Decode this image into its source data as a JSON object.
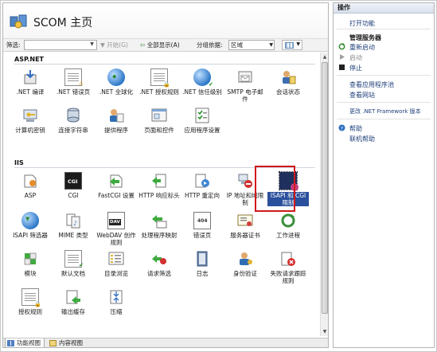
{
  "header": {
    "title": "SCOM 主页",
    "logo_icon": "iis-manager-logo-icon"
  },
  "toolbar": {
    "filter_label": "筛选:",
    "filter_value": "",
    "go_label": "▼ 开始(G)",
    "show_all_label": "全部显示(A)",
    "group_by_label": "分组依据:",
    "group_by_value": "区域",
    "view_icon": "view-tiles-icon"
  },
  "sections": [
    {
      "title": "ASP.NET",
      "items": [
        {
          "label": ".NET 编译",
          "icon": "net-compile-icon"
        },
        {
          "label": ".NET 错误页",
          "icon": "net-error-pages-icon"
        },
        {
          "label": ".NET 全球化",
          "icon": "net-globalization-icon"
        },
        {
          "label": ".NET 授权规则",
          "icon": "net-authorization-rules-icon"
        },
        {
          "label": ".NET 信任级别",
          "icon": "net-trust-levels-icon"
        },
        {
          "label": "SMTP 电子邮件",
          "icon": "smtp-email-icon"
        },
        {
          "label": "会话状态",
          "icon": "session-state-icon"
        },
        {
          "label": "计算机密钥",
          "icon": "machine-key-icon"
        },
        {
          "label": "连接字符串",
          "icon": "connection-strings-icon"
        },
        {
          "label": "提供程序",
          "icon": "providers-icon"
        },
        {
          "label": "页面和控件",
          "icon": "pages-controls-icon"
        },
        {
          "label": "应用程序设置",
          "icon": "application-settings-icon"
        }
      ]
    },
    {
      "title": "IIS",
      "items": [
        {
          "label": "ASP",
          "icon": "asp-icon"
        },
        {
          "label": "CGI",
          "icon": "cgi-icon"
        },
        {
          "label": "FastCGI 设置",
          "icon": "fastcgi-settings-icon"
        },
        {
          "label": "HTTP 响应标头",
          "icon": "http-response-headers-icon"
        },
        {
          "label": "HTTP 重定向",
          "icon": "http-redirect-icon"
        },
        {
          "label": "IP 地址和域限制",
          "icon": "ip-domain-restrictions-icon"
        },
        {
          "label": "ISAPI 和 CGI 限制",
          "icon": "isapi-cgi-restrictions-icon"
        },
        {
          "label": "ISAPI 筛选器",
          "icon": "isapi-filters-icon"
        },
        {
          "label": "MIME 类型",
          "icon": "mime-types-icon"
        },
        {
          "label": "WebDAV 创作规则",
          "icon": "webdav-authoring-rules-icon"
        },
        {
          "label": "处理程序映射",
          "icon": "handler-mappings-icon"
        },
        {
          "label": "错误页",
          "icon": "error-pages-icon"
        },
        {
          "label": "服务器证书",
          "icon": "server-certificates-icon"
        },
        {
          "label": "工作进程",
          "icon": "worker-processes-icon"
        },
        {
          "label": "模块",
          "icon": "modules-icon"
        },
        {
          "label": "默认文档",
          "icon": "default-document-icon"
        },
        {
          "label": "目录浏览",
          "icon": "directory-browsing-icon"
        },
        {
          "label": "请求筛选",
          "icon": "request-filtering-icon"
        },
        {
          "label": "日志",
          "icon": "logging-icon"
        },
        {
          "label": "身份验证",
          "icon": "authentication-icon"
        },
        {
          "label": "失败请求跟踪规则",
          "icon": "failed-request-tracing-icon"
        },
        {
          "label": "授权规则",
          "icon": "authorization-rules-icon"
        },
        {
          "label": "输出缓存",
          "icon": "output-caching-icon"
        },
        {
          "label": "压缩",
          "icon": "compression-icon"
        }
      ]
    }
  ],
  "bottom_tabs": [
    {
      "label": "功能视图",
      "icon": "features-view-icon",
      "active": true
    },
    {
      "label": "内容视图",
      "icon": "content-view-icon",
      "active": false
    }
  ],
  "actions": {
    "title": "操作",
    "open_feature": "打开功能",
    "manage_server_heading": "管理服务器",
    "restart": "重新启动",
    "start": "启动",
    "stop": "停止",
    "view_app_pools": "查看应用程序池",
    "view_sites": "查看网站",
    "change_net_version": "更改 .NET Framework 版本",
    "help": "帮助",
    "online_help": "联机帮助"
  },
  "colors": {
    "highlight_border": "#d11919",
    "selected_bg": "#2a4f9c",
    "link": "#1e3f7a"
  }
}
